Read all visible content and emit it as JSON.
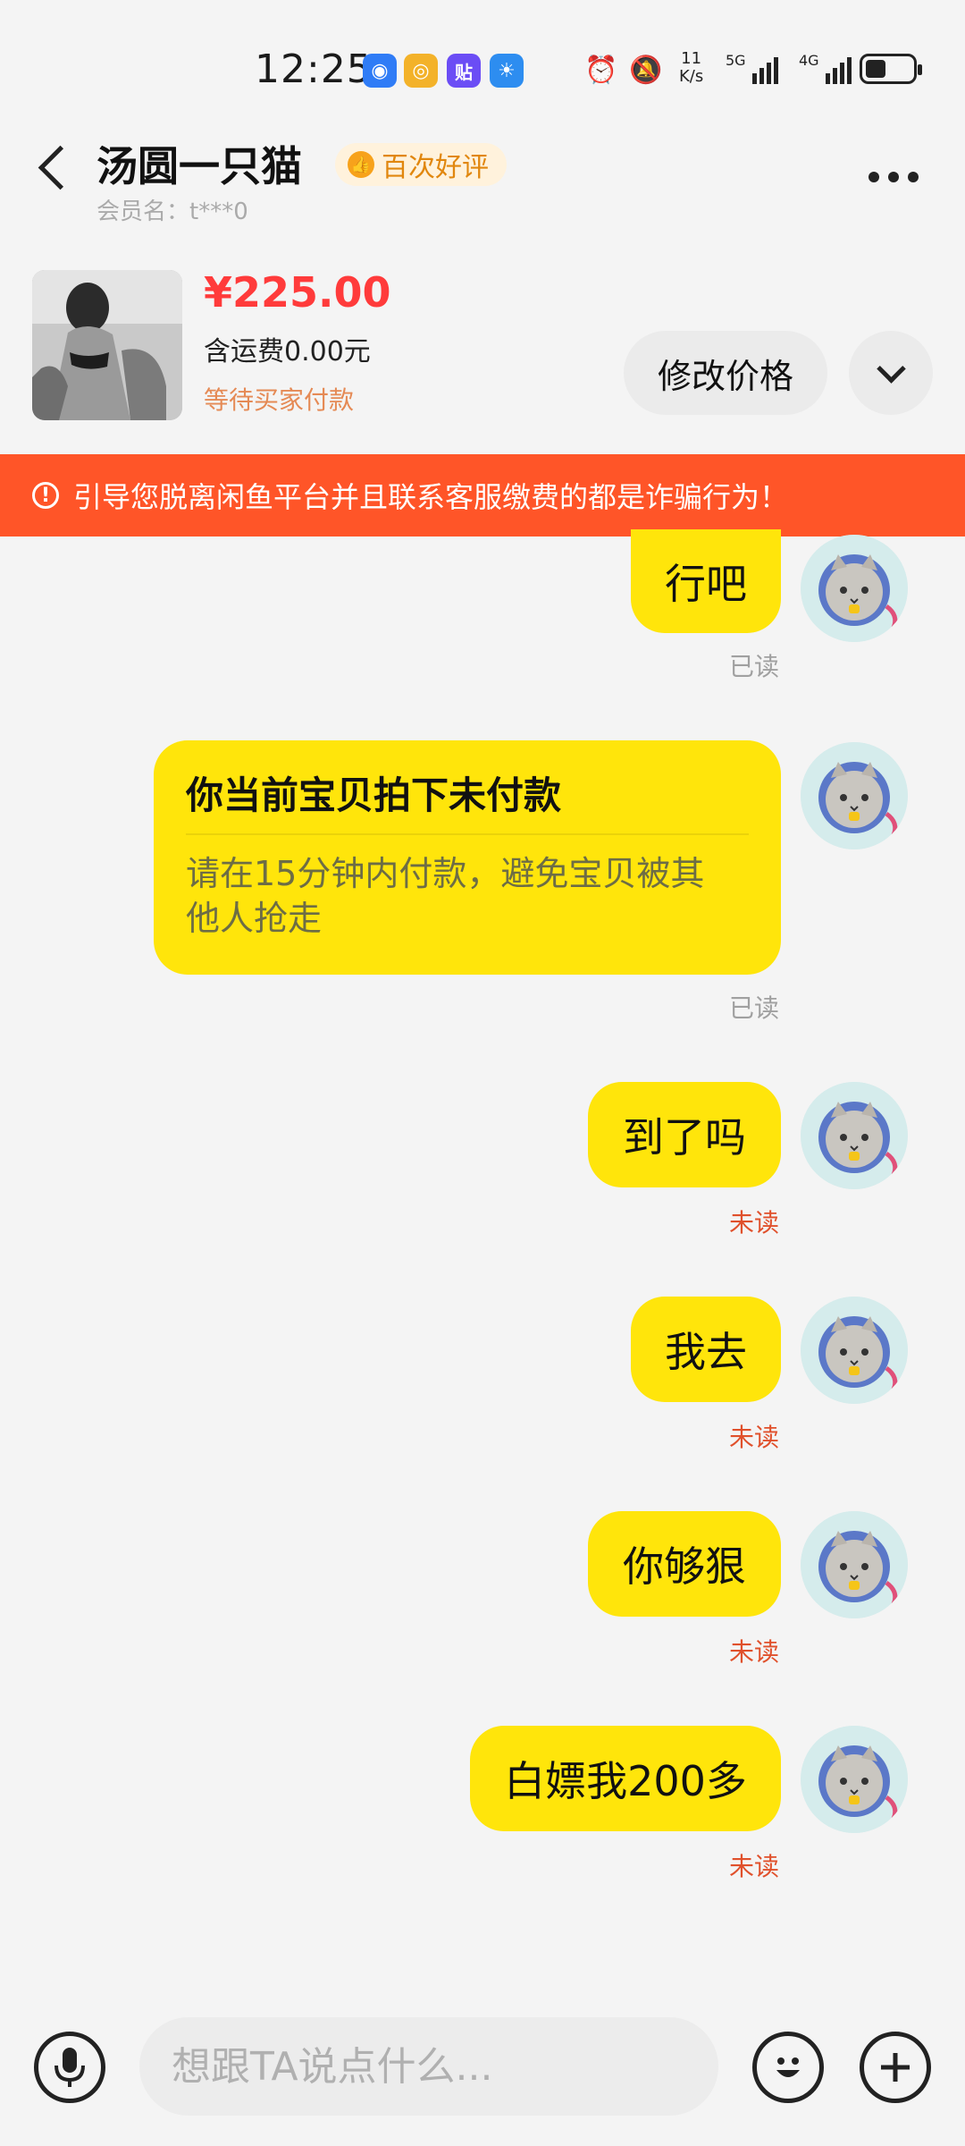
{
  "status_bar": {
    "time": "12:25",
    "net_speed_value": "11",
    "net_speed_unit": "K/s",
    "signal1_label": "5G",
    "signal2_label": "4G",
    "app_badge_text": "贴"
  },
  "header": {
    "title": "汤圆一只猫",
    "badge": "百次好评",
    "member_label": "会员名：t***0"
  },
  "product": {
    "price": "¥225.00",
    "shipping": "含运费0.00元",
    "status": "等待买家付款",
    "edit_price_label": "修改价格"
  },
  "warning": {
    "text": "引导您脱离闲鱼平台并且联系客服缴费的都是诈骗行为！"
  },
  "messages": [
    {
      "text": "行吧",
      "status": "已读"
    },
    {
      "card_title": "你当前宝贝拍下未付款",
      "card_body_line1": "请在15分钟内付款，避免宝贝被其",
      "card_body_line2": "他人抢走",
      "status": "已读"
    },
    {
      "text": "到了吗",
      "status": "未读"
    },
    {
      "text": "我去",
      "status": "未读"
    },
    {
      "text": "你够狠",
      "status": "未读"
    },
    {
      "text": "白嫖我200多",
      "status": "未读"
    }
  ],
  "input": {
    "placeholder": "想跟TA说点什么..."
  },
  "colors": {
    "bubble": "#ffe50b",
    "warning": "#ff5528",
    "price": "#ff3b3b",
    "unread": "#e0502b",
    "read": "#a0a0a0"
  },
  "icons": [
    "back-icon",
    "more-icon",
    "chevron-down-icon",
    "warning-icon",
    "thumbs-up-icon",
    "mic-icon",
    "emoji-icon",
    "plus-icon",
    "alarm-icon",
    "mute-icon",
    "battery-icon"
  ]
}
